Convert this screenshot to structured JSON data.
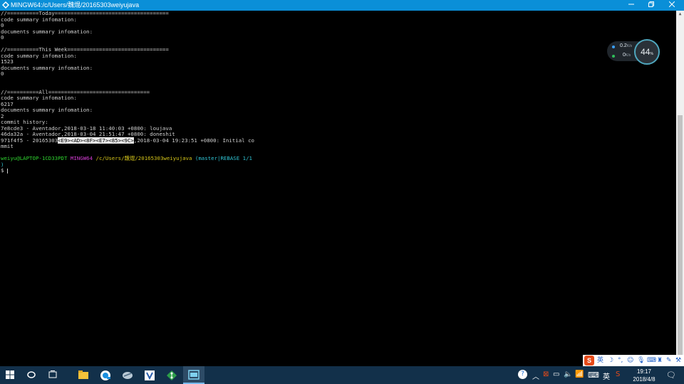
{
  "window": {
    "title": "MINGW64:/c/Users/魏焜/20165303weiyujava",
    "controls": [
      "minimize",
      "maximize",
      "close"
    ]
  },
  "terminal": {
    "lines": [
      "//==========Today====================================",
      "code summary infomation:",
      "0",
      "documents summary infomation:",
      "0",
      "",
      "//==========This Week================================",
      "code summary infomation:",
      "1523",
      "documents summary infomation:",
      "0",
      "",
      "",
      "//==========All================================",
      "code summary infomation:",
      "6217",
      "documents summary infomation:",
      "2",
      "commit history:",
      "7e8cde3 - Aventador,2018-03-18 11:40:03 +0800: loujava",
      "46da32a - Aventador,2018-03-04 21:51:47 +0800: doneshit"
    ],
    "commit3": {
      "prefix": "971f4f5 - 20165303",
      "highlight": "<E9><AD><8F><E7><85><9C>",
      "suffix": ",2018-03-04 19:23:51 +0800: Initial co",
      "wrap": "mmit"
    },
    "prompt": {
      "user": "weiyu@LAPTOP-1CD33PDT",
      "shell": "MINGW64",
      "path": "/c/Users/魏焜/20165303weiyujava",
      "branch": "(master|REBASE 1/1",
      "branch_wrap": ")",
      "symbol": "$"
    }
  },
  "network_widget": {
    "upload": "0.2",
    "download": "0",
    "unit": "K/s",
    "percent": "44",
    "percent_unit": "%"
  },
  "ime_toolbar": {
    "logo": "S",
    "lang": "英",
    "icons": [
      "moon-icon",
      "punctuation-icon",
      "emoji-icon",
      "microphone-icon",
      "keyboard-icon",
      "shirt-icon",
      "tools-icon"
    ]
  },
  "taskbar": {
    "apps": [
      "start-icon",
      "cortana-icon",
      "task-view-icon",
      "file-explorer-icon",
      "browser-icon",
      "app-icon",
      "visual-studio-icon",
      "git-icon",
      "terminal-icon"
    ],
    "tray_lang": "英",
    "time": "19:17",
    "date": "2018/4/8"
  }
}
